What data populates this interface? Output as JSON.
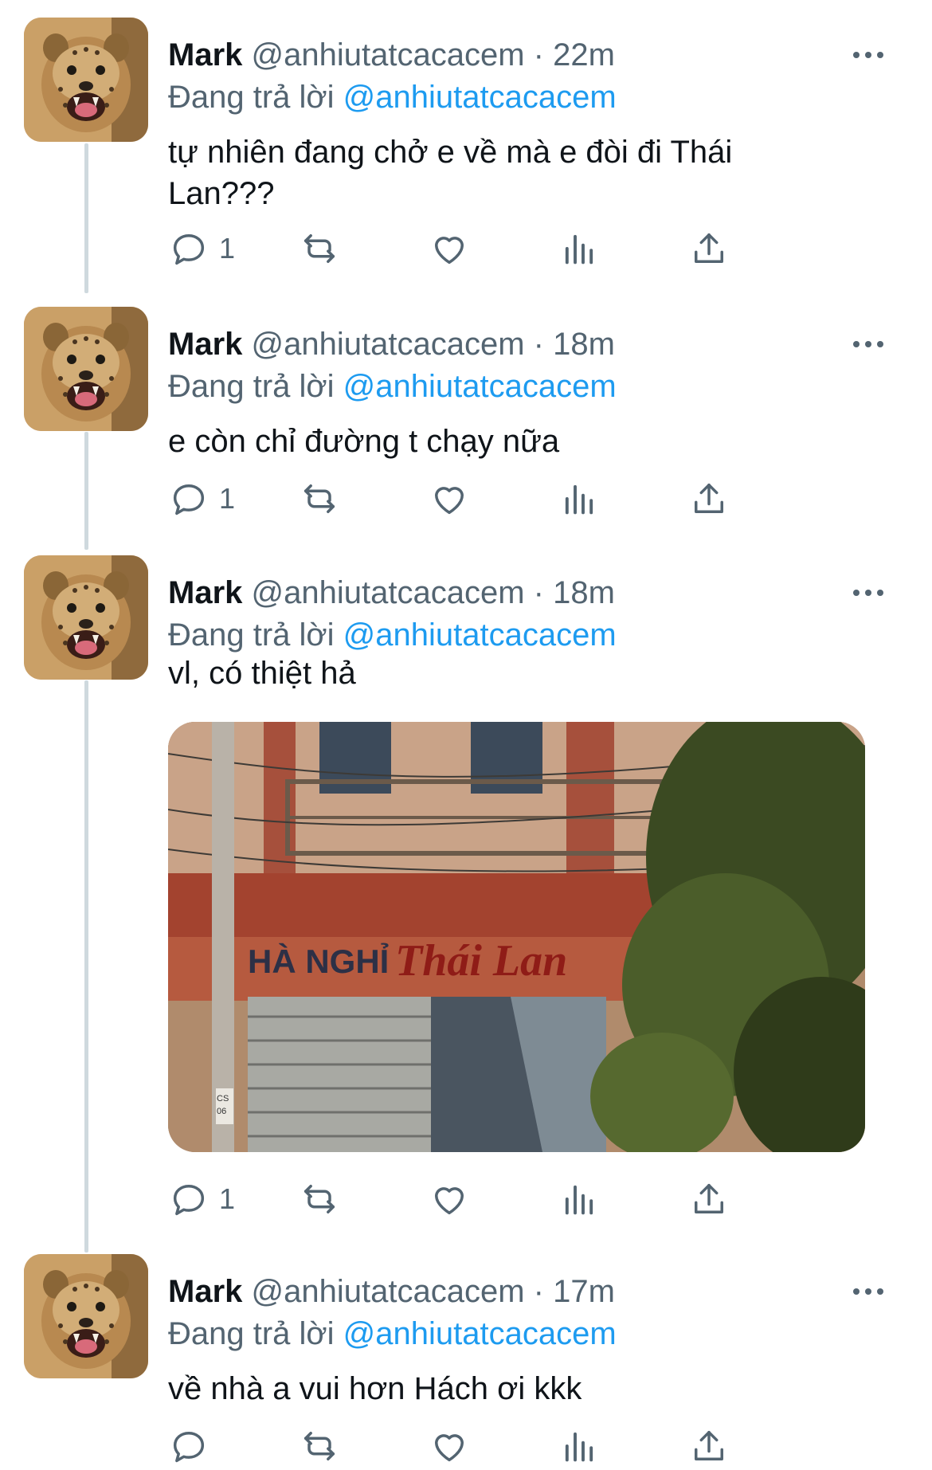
{
  "tweets": [
    {
      "name": "Mark",
      "handle": "@anhiutatcacacem",
      "separator": "·",
      "time": "22m",
      "reply_prefix": "Đang trả lời",
      "reply_to": "@anhiutatcacacem",
      "text": "tự nhiên đang chở e về mà e đòi đi Thái Lan???",
      "reply_count": "1"
    },
    {
      "name": "Mark",
      "handle": "@anhiutatcacacem",
      "separator": "·",
      "time": "18m",
      "reply_prefix": "Đang trả lời",
      "reply_to": "@anhiutatcacacem",
      "text": "e còn chỉ đường t chạy nữa",
      "reply_count": "1"
    },
    {
      "name": "Mark",
      "handle": "@anhiutatcacacem",
      "separator": "·",
      "time": "18m",
      "reply_prefix": "Đang trả lời",
      "reply_to": "@anhiutatcacacem",
      "text": "vl, có thiệt hả",
      "reply_count": "1",
      "photo": {
        "sign_left": "HÀ NGHỈ",
        "sign_right": "Thái Lan",
        "plate_top": "CS",
        "plate_num": "06"
      }
    },
    {
      "name": "Mark",
      "handle": "@anhiutatcacacem",
      "separator": "·",
      "time": "17m",
      "reply_prefix": "Đang trả lời",
      "reply_to": "@anhiutatcacacem",
      "text": "về nhà a vui hơn Hách ơi kkk",
      "reply_count": ""
    }
  ],
  "icons": {
    "reply": "reply-icon",
    "retweet": "retweet-icon",
    "like": "heart-icon",
    "views": "analytics-icon",
    "share": "share-icon",
    "more": "more-icon"
  },
  "colors": {
    "accent": "#1d9bf0",
    "secondary_text": "#536471",
    "thread_line": "#cfd9de"
  }
}
